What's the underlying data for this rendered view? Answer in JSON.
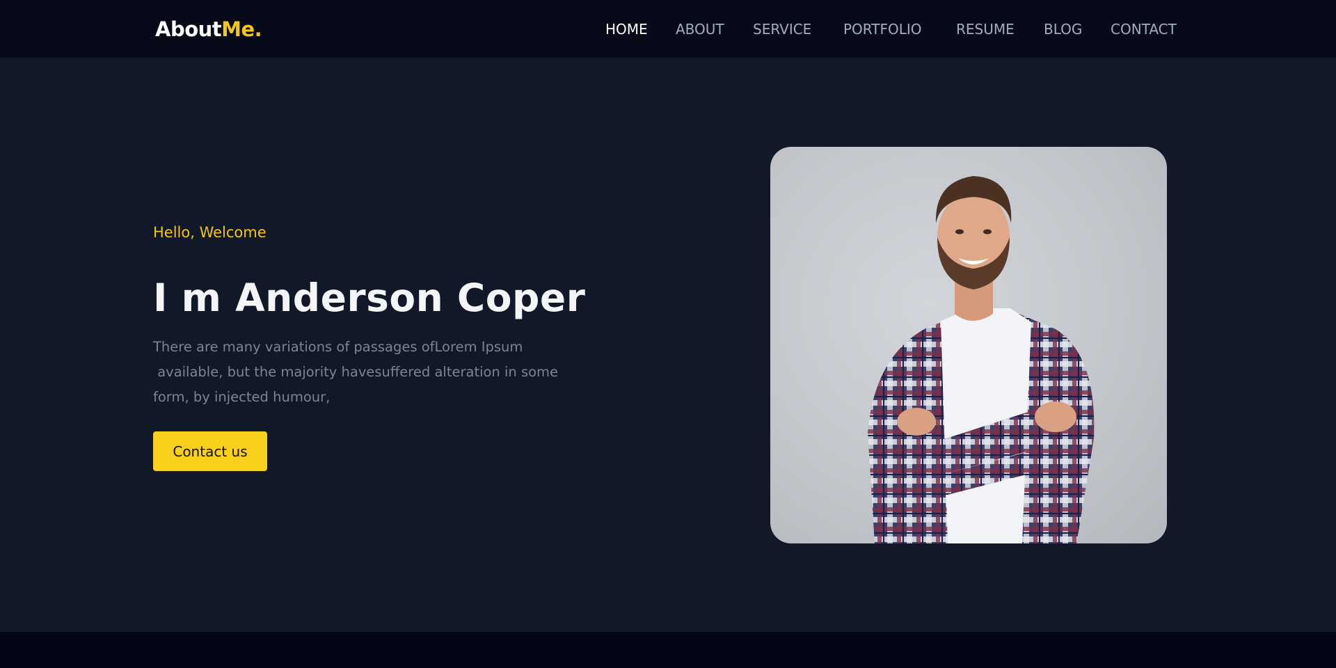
{
  "logo": {
    "main": "About",
    "accent": "Me."
  },
  "nav": {
    "items": [
      {
        "label": "HOME",
        "active": true
      },
      {
        "label": "ABOUT",
        "active": false
      },
      {
        "label": "SERVICE",
        "active": false
      },
      {
        "label": "PORTFOLIO",
        "active": false
      },
      {
        "label": "RESUME",
        "active": false
      },
      {
        "label": "BLOG",
        "active": false
      },
      {
        "label": "CONTACT",
        "active": false
      }
    ]
  },
  "hero": {
    "greeting": "Hello, Welcome",
    "title": "I m Anderson Coper",
    "description_lines": [
      "There are many variations of passages ofLorem Ipsum",
      " available, but the majority havesuffered alteration in some",
      "form, by injected humour,"
    ],
    "cta_label": "Contact us",
    "photo_alt": "Smiling man with beard in plaid shirt, arms crossed"
  },
  "colors": {
    "background": "#111827",
    "nav_background": "#070a18",
    "accent": "#f5c518",
    "button": "#f9d01c"
  }
}
